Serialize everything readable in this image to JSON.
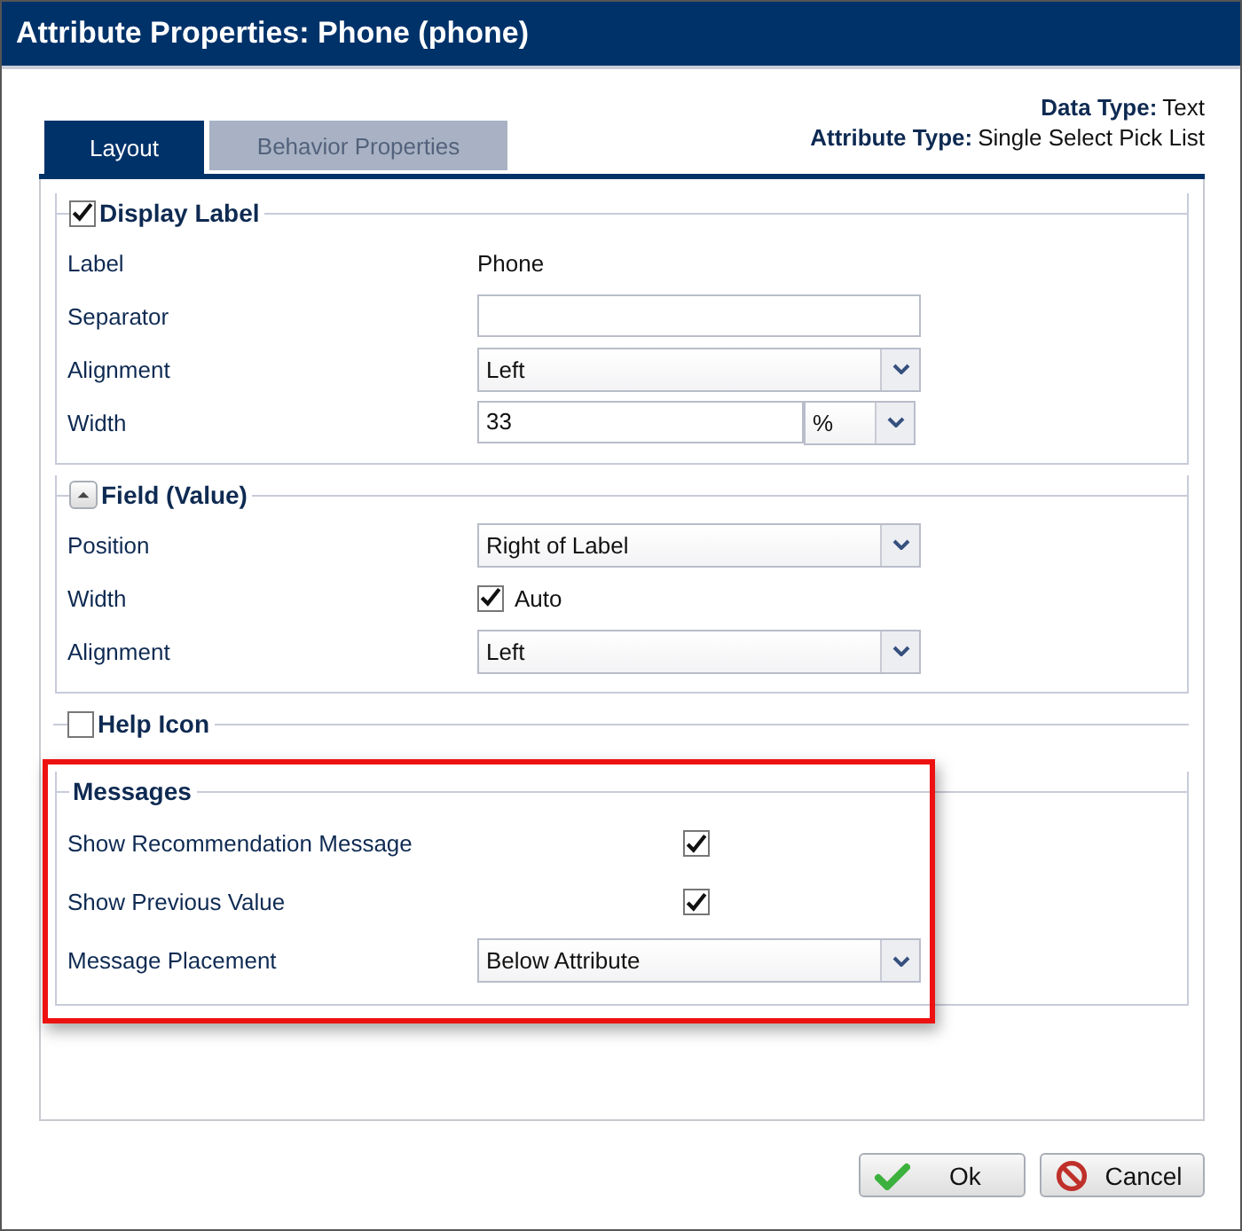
{
  "window": {
    "title": "Attribute Properties: Phone (phone)"
  },
  "info": [
    {
      "label": "Data Type:",
      "value": "Text"
    },
    {
      "label": "Attribute Type:",
      "value": "Single Select Pick List"
    }
  ],
  "tabs": [
    {
      "label": "Layout",
      "selected": true
    },
    {
      "label": "Behavior Properties",
      "selected": false
    }
  ],
  "sections": [
    {
      "title": "Display Label",
      "kind": "checkbox",
      "checked": true,
      "rows": [
        {
          "label": "Label",
          "kind": "text",
          "value": "Phone"
        },
        {
          "label": "Separator",
          "kind": "input"
        },
        {
          "label": "Alignment",
          "kind": "select",
          "value": "Left"
        },
        {
          "label": "Width",
          "kind": "input_unit",
          "value": "33",
          "unit": "%"
        }
      ]
    },
    {
      "title": "Field (Value)",
      "kind": "collapse",
      "expanded": true,
      "rows": [
        {
          "label": "Position",
          "kind": "select",
          "value": "Right of Label"
        },
        {
          "label": "Width",
          "kind": "checkbox",
          "checked": true,
          "text": "Auto"
        },
        {
          "label": "Alignment",
          "kind": "select",
          "value": "Left"
        }
      ]
    },
    {
      "title": "Help Icon",
      "kind": "checkbox",
      "checked": false
    },
    {
      "title": "Messages",
      "kind": "plain",
      "highlighted": true,
      "rows": [
        {
          "label": "Show Recommendation Message",
          "kind": "checkbox",
          "checked": true
        },
        {
          "label": "Show Previous Value",
          "kind": "checkbox",
          "checked": true
        },
        {
          "label": "Message Placement",
          "kind": "select",
          "value": "Below Attribute"
        }
      ]
    }
  ],
  "buttons": [
    {
      "label": "Ok",
      "kind": "ok"
    },
    {
      "label": "Cancel",
      "kind": "cancel"
    }
  ]
}
